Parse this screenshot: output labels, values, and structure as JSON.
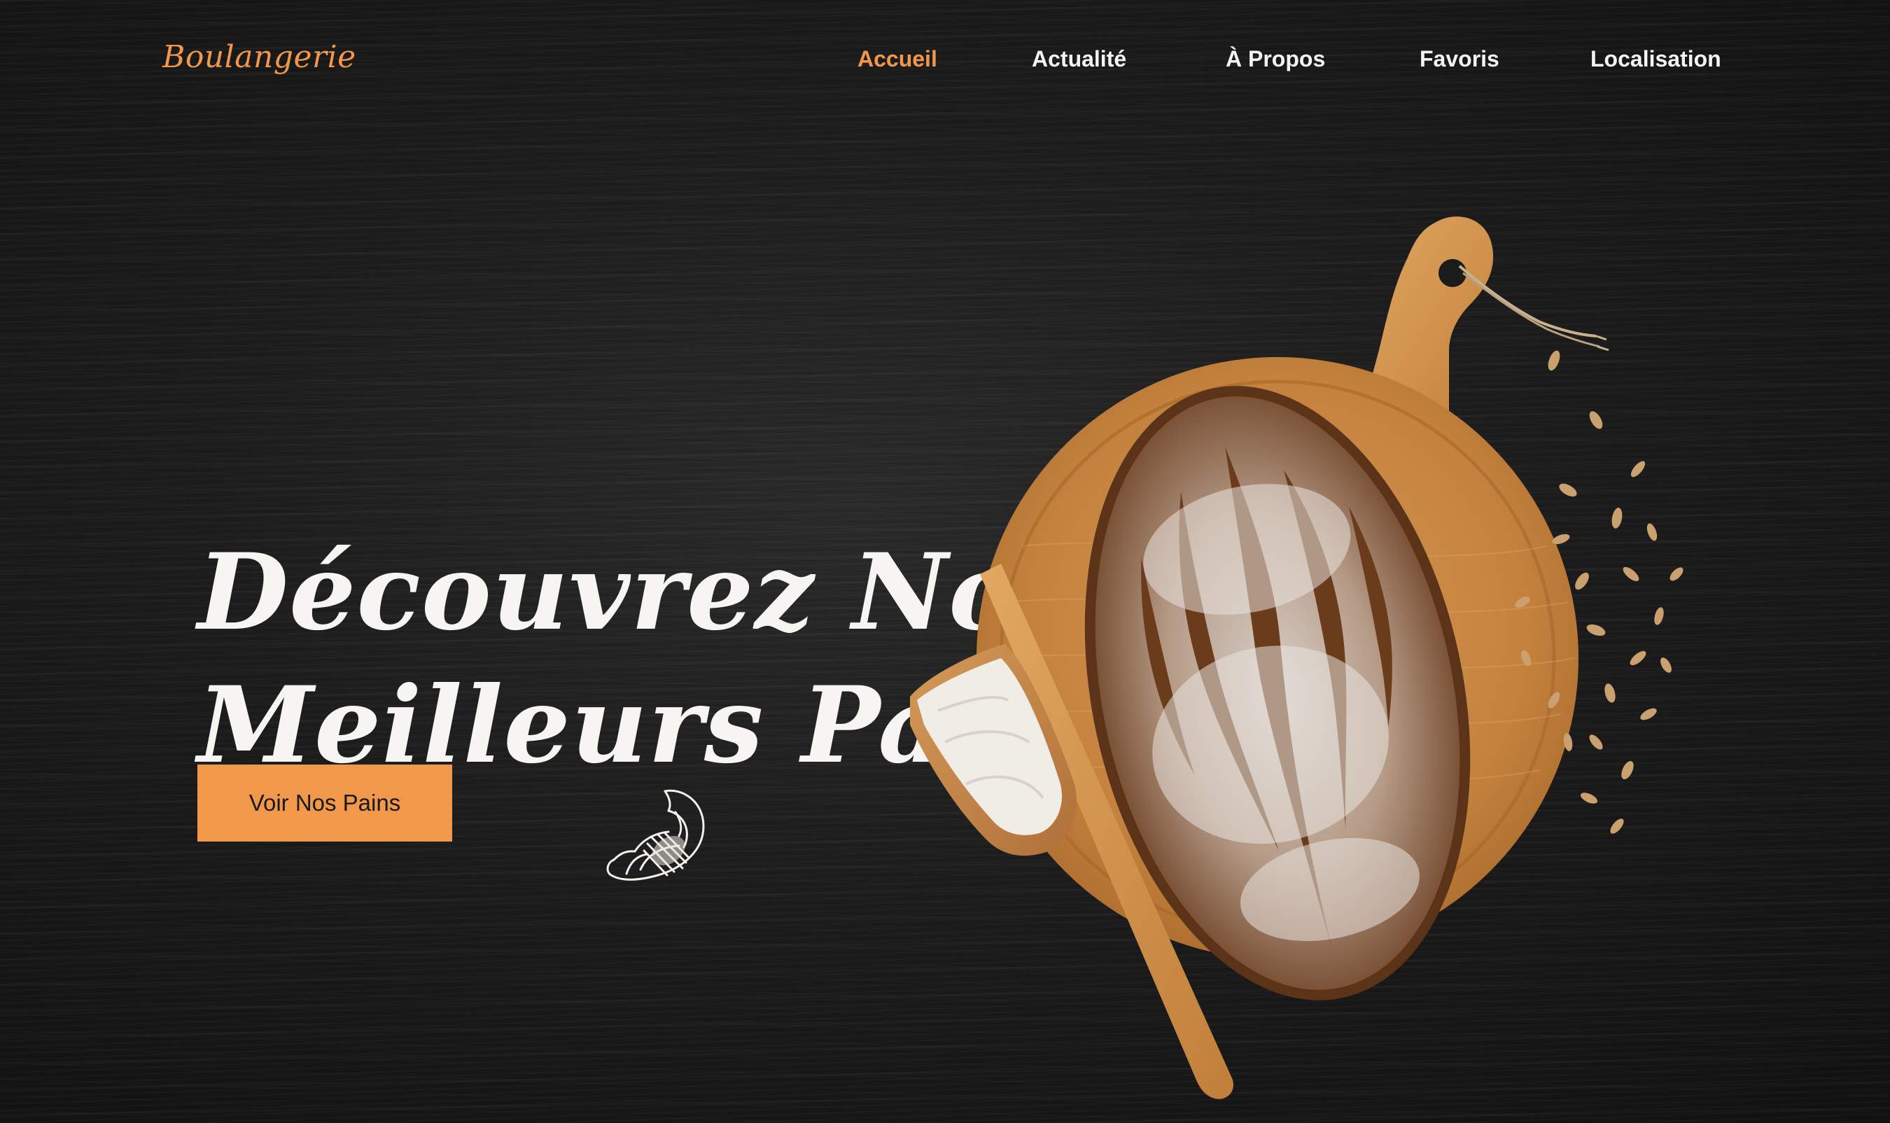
{
  "brand": {
    "logo": "Boulangerie"
  },
  "nav": {
    "items": [
      {
        "label": "Accueil",
        "active": true
      },
      {
        "label": "Actualité",
        "active": false
      },
      {
        "label": "À Propos",
        "active": false
      },
      {
        "label": "Favoris",
        "active": false
      },
      {
        "label": "Localisation",
        "active": false
      }
    ]
  },
  "hero": {
    "title_line1": "Découvrez Nos",
    "title_line2": "Meilleurs Pains",
    "cta_label": "Voir Nos Pains"
  },
  "icons": {
    "croissant": "croissant-sketch-icon",
    "bread": "bread-on-cutting-board-image"
  },
  "colors": {
    "accent": "#f2984b",
    "background": "#171717",
    "text": "#f7f5f1"
  }
}
